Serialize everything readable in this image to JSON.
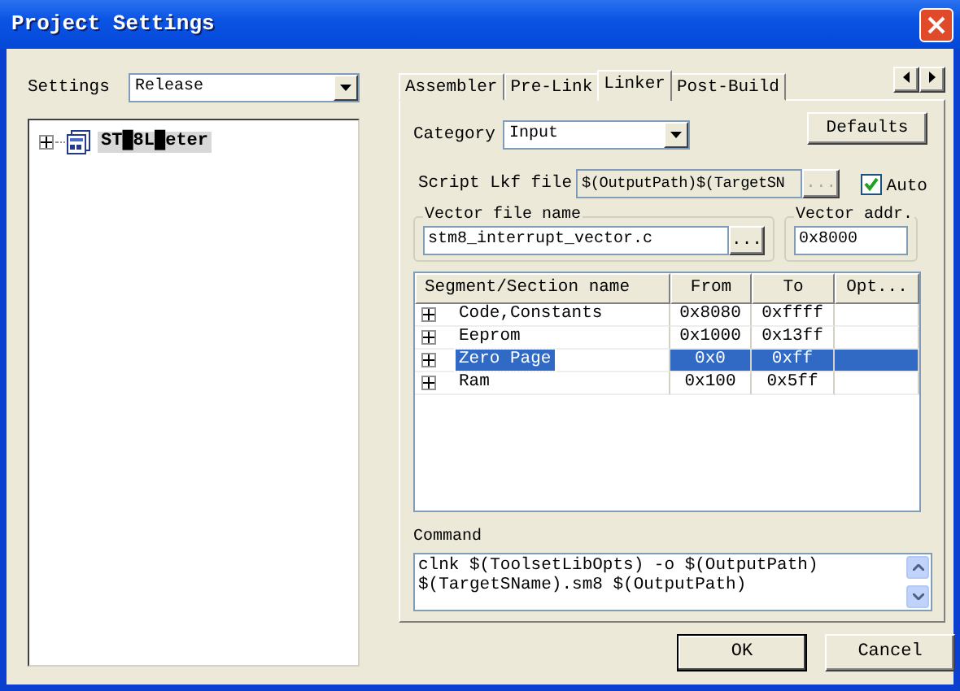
{
  "window": {
    "title": "Project Settings"
  },
  "settings": {
    "label": "Settings",
    "value": "Release"
  },
  "tree": [
    {
      "label": "ST█8L█eter",
      "expanded": false,
      "selected": true
    }
  ],
  "tabs": [
    {
      "label": "Assembler",
      "selected": false
    },
    {
      "label": "Pre-Link",
      "selected": false
    },
    {
      "label": "Linker",
      "selected": true
    },
    {
      "label": "Post-Build",
      "selected": false
    }
  ],
  "linker": {
    "category": {
      "label": "Category",
      "value": "Input"
    },
    "defaults_button": "Defaults",
    "script_file": {
      "label": "Script Lkf file",
      "value": "$(OutputPath)$(TargetSN",
      "browse": "...",
      "disabled": true
    },
    "auto": {
      "label": "Auto",
      "checked": true
    },
    "vector_file": {
      "legend": "Vector file name",
      "value": "stm8_interrupt_vector.c",
      "browse": "..."
    },
    "vector_addr": {
      "legend": "Vector addr.",
      "value": "0x8000"
    },
    "table": {
      "columns": [
        "Segment/Section name",
        "From",
        "To",
        "Opt..."
      ],
      "rows": [
        {
          "name": "Code,Constants",
          "from": "0x8080",
          "to": "0xffff",
          "expanded": false,
          "selected": false
        },
        {
          "name": "Eeprom",
          "from": "0x1000",
          "to": "0x13ff",
          "expanded": false,
          "selected": false
        },
        {
          "name": "Zero Page",
          "from": "0x0",
          "to": "0xff",
          "expanded": false,
          "selected": true
        },
        {
          "name": "Ram",
          "from": "0x100",
          "to": "0x5ff",
          "expanded": false,
          "selected": false
        }
      ]
    },
    "command": {
      "label": "Command",
      "lines": [
        "clnk $(ToolsetLibOpts) -o $(OutputPath)",
        "$(TargetSName).sm8 $(OutputPath)"
      ]
    }
  },
  "buttons": [
    {
      "label": "OK",
      "default": true
    },
    {
      "label": "Cancel",
      "default": false
    }
  ]
}
